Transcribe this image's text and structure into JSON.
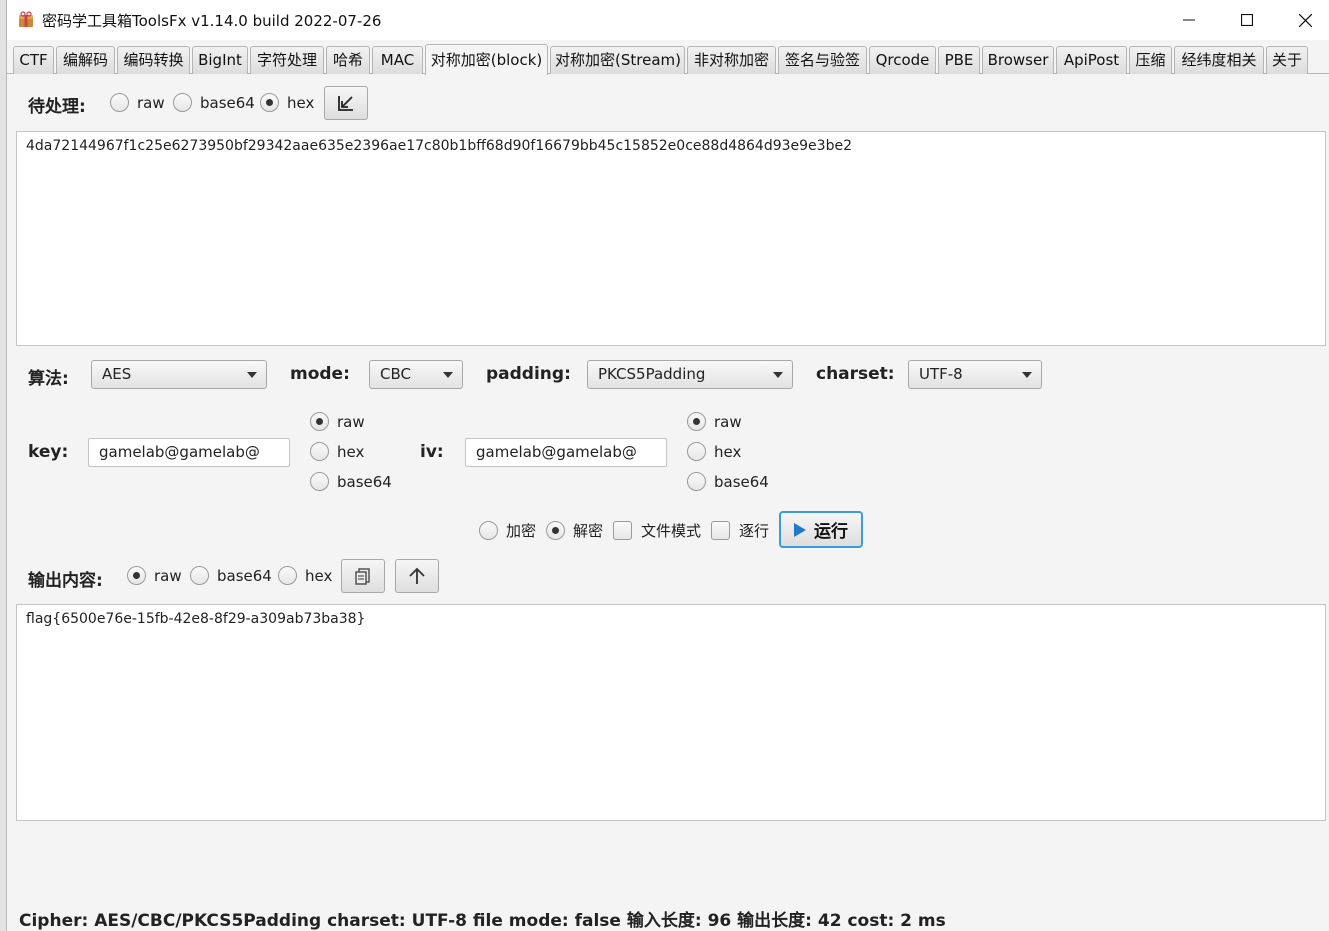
{
  "window": {
    "title": "密码学工具箱ToolsFx v1.14.0 build 2022-07-26"
  },
  "tabs": [
    {
      "label": "CTF"
    },
    {
      "label": "编解码"
    },
    {
      "label": "编码转换"
    },
    {
      "label": "BigInt"
    },
    {
      "label": "字符处理"
    },
    {
      "label": "哈希"
    },
    {
      "label": "MAC"
    },
    {
      "label": "对称加密(block)",
      "active": true
    },
    {
      "label": "对称加密(Stream)"
    },
    {
      "label": "非对称加密"
    },
    {
      "label": "签名与验签"
    },
    {
      "label": "Qrcode"
    },
    {
      "label": "PBE"
    },
    {
      "label": "Browser"
    },
    {
      "label": "ApiPost"
    },
    {
      "label": "压缩"
    },
    {
      "label": "经纬度相关"
    },
    {
      "label": "关于"
    }
  ],
  "input": {
    "label": "待处理:",
    "encodings": [
      {
        "label": "raw",
        "selected": false
      },
      {
        "label": "base64",
        "selected": false
      },
      {
        "label": "hex",
        "selected": true
      }
    ],
    "import_icon": "import-arrow-icon",
    "text": "4da72144967f1c25e6273950bf29342aae635e2396ae17c80b1bff68d90f16679bb45c15852e0ce88d4864d93e9e3be2"
  },
  "config": {
    "algorithm_label": "算法:",
    "algorithm_value": "AES",
    "mode_label": "mode:",
    "mode_value": "CBC",
    "padding_label": "padding:",
    "padding_value": "PKCS5Padding",
    "charset_label": "charset:",
    "charset_value": "UTF-8"
  },
  "key": {
    "label": "key:",
    "value": "gamelab@gamelab@",
    "encodings": [
      {
        "label": "raw",
        "selected": true
      },
      {
        "label": "hex",
        "selected": false
      },
      {
        "label": "base64",
        "selected": false
      }
    ]
  },
  "iv": {
    "label": "iv:",
    "value": "gamelab@gamelab@",
    "encodings": [
      {
        "label": "raw",
        "selected": true
      },
      {
        "label": "hex",
        "selected": false
      },
      {
        "label": "base64",
        "selected": false
      }
    ]
  },
  "actions": {
    "encrypt_label": "加密",
    "encrypt_selected": false,
    "decrypt_label": "解密",
    "decrypt_selected": true,
    "file_mode_label": "文件模式",
    "file_mode_checked": false,
    "line_by_line_label": "逐行",
    "line_by_line_checked": false,
    "run_label": "运行",
    "run_icon": "play-icon",
    "accent_color": "#3c9adf"
  },
  "output": {
    "label": "输出内容:",
    "encodings": [
      {
        "label": "raw",
        "selected": true
      },
      {
        "label": "base64",
        "selected": false
      },
      {
        "label": "hex",
        "selected": false
      }
    ],
    "copy_icon": "copy-icon",
    "move_up_icon": "up-arrow-icon",
    "text": "flag{6500e76e-15fb-42e8-8f29-a309ab73ba38}"
  },
  "status": {
    "text": "Cipher: AES/CBC/PKCS5Padding   charset: UTF-8  file mode:  false 输入长度: 96  输出长度: 42  cost: 2 ms"
  }
}
